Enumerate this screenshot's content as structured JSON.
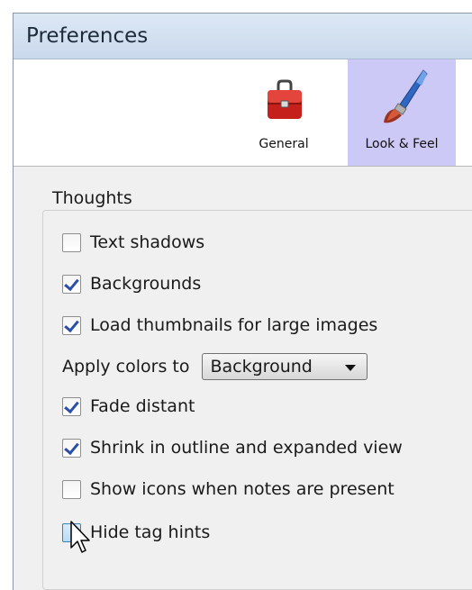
{
  "window": {
    "title": "Preferences"
  },
  "toolbar": {
    "items": [
      {
        "label": "General",
        "icon": "toolbox-icon",
        "selected": false
      },
      {
        "label": "Look & Feel",
        "icon": "paintbrush-icon",
        "selected": true
      }
    ]
  },
  "group": {
    "title": "Thoughts"
  },
  "options": [
    {
      "label": "Text shadows",
      "checked": false
    },
    {
      "label": "Backgrounds",
      "checked": true
    },
    {
      "label": "Load thumbnails for large images",
      "checked": true
    },
    {
      "label": "Fade distant",
      "checked": true
    },
    {
      "label": "Shrink in outline and expanded view",
      "checked": true
    },
    {
      "label": "Show icons when notes are present",
      "checked": false
    },
    {
      "label": "Hide tag hints",
      "checked": false
    }
  ],
  "apply_colors": {
    "label": "Apply colors to",
    "selected": "Background"
  },
  "colors": {
    "selection": "#cdc9f7",
    "title_bar": "#c9d9ec",
    "check": "#2b4ea6"
  }
}
